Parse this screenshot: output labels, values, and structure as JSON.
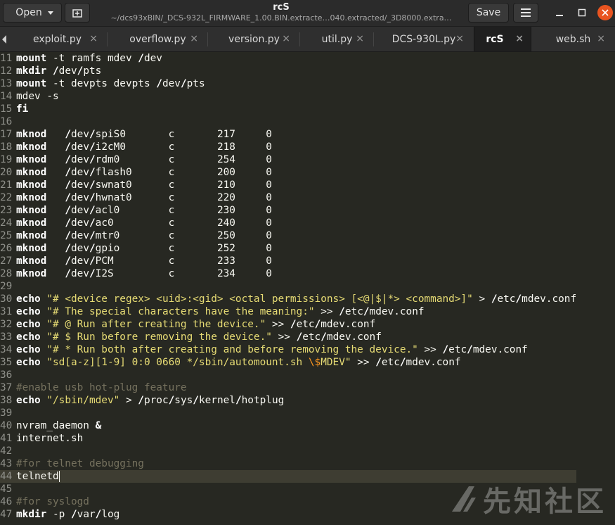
{
  "header": {
    "open_label": "Open",
    "title": "rcS",
    "subtitle": "~/dcs93xBIN/_DCS-932L_FIRMWARE_1.00.BIN.extracte…040.extracted/_3D8000.extra…",
    "save_label": "Save"
  },
  "tabs": [
    {
      "label": "exploit.py",
      "close": "×"
    },
    {
      "label": "overflow.py",
      "close": "×"
    },
    {
      "label": "version.py",
      "close": "×"
    },
    {
      "label": "util.py",
      "close": "×"
    },
    {
      "label": "DCS-930L.py",
      "close": "×"
    },
    {
      "label": "rcS",
      "close": "×",
      "active": true
    },
    {
      "label": "web.sh",
      "close": "×"
    }
  ],
  "editor": {
    "lines": [
      {
        "n": "11",
        "tokens": [
          [
            "kw",
            "mount"
          ],
          [
            "t",
            " -t ramfs mdev "
          ],
          [
            "op",
            "/"
          ],
          [
            "t",
            "dev"
          ]
        ]
      },
      {
        "n": "12",
        "tokens": [
          [
            "kw",
            "mkdir"
          ],
          [
            "t",
            " "
          ],
          [
            "op",
            "/"
          ],
          [
            "t",
            "dev"
          ],
          [
            "op",
            "/"
          ],
          [
            "t",
            "pts"
          ]
        ]
      },
      {
        "n": "13",
        "tokens": [
          [
            "kw",
            "mount"
          ],
          [
            "t",
            " -t devpts devpts "
          ],
          [
            "op",
            "/"
          ],
          [
            "t",
            "dev"
          ],
          [
            "op",
            "/"
          ],
          [
            "t",
            "pts"
          ]
        ]
      },
      {
        "n": "14",
        "tokens": [
          [
            "t",
            "mdev -s"
          ]
        ]
      },
      {
        "n": "15",
        "tokens": [
          [
            "kw",
            "fi"
          ]
        ]
      },
      {
        "n": "16",
        "tokens": []
      },
      {
        "n": "17",
        "tokens": [
          [
            "kw",
            "mknod"
          ],
          [
            "t",
            "   "
          ],
          [
            "op",
            "/"
          ],
          [
            "t",
            "dev"
          ],
          [
            "op",
            "/"
          ],
          [
            "t",
            "spiS0       c       217     0"
          ]
        ]
      },
      {
        "n": "18",
        "tokens": [
          [
            "kw",
            "mknod"
          ],
          [
            "t",
            "   "
          ],
          [
            "op",
            "/"
          ],
          [
            "t",
            "dev"
          ],
          [
            "op",
            "/"
          ],
          [
            "t",
            "i2cM0       c       218     0"
          ]
        ]
      },
      {
        "n": "19",
        "tokens": [
          [
            "kw",
            "mknod"
          ],
          [
            "t",
            "   "
          ],
          [
            "op",
            "/"
          ],
          [
            "t",
            "dev"
          ],
          [
            "op",
            "/"
          ],
          [
            "t",
            "rdm0        c       254     0"
          ]
        ]
      },
      {
        "n": "20",
        "tokens": [
          [
            "kw",
            "mknod"
          ],
          [
            "t",
            "   "
          ],
          [
            "op",
            "/"
          ],
          [
            "t",
            "dev"
          ],
          [
            "op",
            "/"
          ],
          [
            "t",
            "flash0      c       200     0"
          ]
        ]
      },
      {
        "n": "21",
        "tokens": [
          [
            "kw",
            "mknod"
          ],
          [
            "t",
            "   "
          ],
          [
            "op",
            "/"
          ],
          [
            "t",
            "dev"
          ],
          [
            "op",
            "/"
          ],
          [
            "t",
            "swnat0      c       210     0"
          ]
        ]
      },
      {
        "n": "22",
        "tokens": [
          [
            "kw",
            "mknod"
          ],
          [
            "t",
            "   "
          ],
          [
            "op",
            "/"
          ],
          [
            "t",
            "dev"
          ],
          [
            "op",
            "/"
          ],
          [
            "t",
            "hwnat0      c       220     0"
          ]
        ]
      },
      {
        "n": "23",
        "tokens": [
          [
            "kw",
            "mknod"
          ],
          [
            "t",
            "   "
          ],
          [
            "op",
            "/"
          ],
          [
            "t",
            "dev"
          ],
          [
            "op",
            "/"
          ],
          [
            "t",
            "acl0        c       230     0"
          ]
        ]
      },
      {
        "n": "24",
        "tokens": [
          [
            "kw",
            "mknod"
          ],
          [
            "t",
            "   "
          ],
          [
            "op",
            "/"
          ],
          [
            "t",
            "dev"
          ],
          [
            "op",
            "/"
          ],
          [
            "t",
            "ac0         c       240     0"
          ]
        ]
      },
      {
        "n": "25",
        "tokens": [
          [
            "kw",
            "mknod"
          ],
          [
            "t",
            "   "
          ],
          [
            "op",
            "/"
          ],
          [
            "t",
            "dev"
          ],
          [
            "op",
            "/"
          ],
          [
            "t",
            "mtr0        c       250     0"
          ]
        ]
      },
      {
        "n": "26",
        "tokens": [
          [
            "kw",
            "mknod"
          ],
          [
            "t",
            "   "
          ],
          [
            "op",
            "/"
          ],
          [
            "t",
            "dev"
          ],
          [
            "op",
            "/"
          ],
          [
            "t",
            "gpio        c       252     0"
          ]
        ]
      },
      {
        "n": "27",
        "tokens": [
          [
            "kw",
            "mknod"
          ],
          [
            "t",
            "   "
          ],
          [
            "op",
            "/"
          ],
          [
            "t",
            "dev"
          ],
          [
            "op",
            "/"
          ],
          [
            "t",
            "PCM         c       233     0"
          ]
        ]
      },
      {
        "n": "28",
        "tokens": [
          [
            "kw",
            "mknod"
          ],
          [
            "t",
            "   "
          ],
          [
            "op",
            "/"
          ],
          [
            "t",
            "dev"
          ],
          [
            "op",
            "/"
          ],
          [
            "t",
            "I2S         c       234     0"
          ]
        ]
      },
      {
        "n": "29",
        "tokens": []
      },
      {
        "n": "30",
        "tokens": [
          [
            "kw",
            "echo"
          ],
          [
            "t",
            " "
          ],
          [
            "str",
            "\"# <device regex> <uid>:<gid> <octal permissions> [<@|$|*> <command>]\""
          ],
          [
            "t",
            " > "
          ],
          [
            "op",
            "/"
          ],
          [
            "t",
            "etc"
          ],
          [
            "op",
            "/"
          ],
          [
            "t",
            "mdev.conf"
          ]
        ]
      },
      {
        "n": "31",
        "tokens": [
          [
            "kw",
            "echo"
          ],
          [
            "t",
            " "
          ],
          [
            "str",
            "\"# The special characters have the meaning:\""
          ],
          [
            "t",
            " >> "
          ],
          [
            "op",
            "/"
          ],
          [
            "t",
            "etc"
          ],
          [
            "op",
            "/"
          ],
          [
            "t",
            "mdev.conf"
          ]
        ]
      },
      {
        "n": "32",
        "tokens": [
          [
            "kw",
            "echo"
          ],
          [
            "t",
            " "
          ],
          [
            "str",
            "\"# @ Run after creating the device.\""
          ],
          [
            "t",
            " >> "
          ],
          [
            "op",
            "/"
          ],
          [
            "t",
            "etc"
          ],
          [
            "op",
            "/"
          ],
          [
            "t",
            "mdev.conf"
          ]
        ]
      },
      {
        "n": "33",
        "tokens": [
          [
            "kw",
            "echo"
          ],
          [
            "t",
            " "
          ],
          [
            "str",
            "\"# $ Run before removing the device.\""
          ],
          [
            "t",
            " >> "
          ],
          [
            "op",
            "/"
          ],
          [
            "t",
            "etc"
          ],
          [
            "op",
            "/"
          ],
          [
            "t",
            "mdev.conf"
          ]
        ]
      },
      {
        "n": "34",
        "tokens": [
          [
            "kw",
            "echo"
          ],
          [
            "t",
            " "
          ],
          [
            "str",
            "\"# * Run both after creating and before removing the device.\""
          ],
          [
            "t",
            " >> "
          ],
          [
            "op",
            "/"
          ],
          [
            "t",
            "etc"
          ],
          [
            "op",
            "/"
          ],
          [
            "t",
            "mdev.conf"
          ]
        ]
      },
      {
        "n": "35",
        "tokens": [
          [
            "kw",
            "echo"
          ],
          [
            "t",
            " "
          ],
          [
            "str",
            "\"sd[a-z][1-9] 0:0 0660 */sbin/automount.sh "
          ],
          [
            "var",
            "\\$"
          ],
          [
            "str",
            "MDEV\""
          ],
          [
            "t",
            " >> "
          ],
          [
            "op",
            "/"
          ],
          [
            "t",
            "etc"
          ],
          [
            "op",
            "/"
          ],
          [
            "t",
            "mdev.conf"
          ]
        ]
      },
      {
        "n": "36",
        "tokens": []
      },
      {
        "n": "37",
        "tokens": [
          [
            "cm",
            "#enable usb hot-plug feature"
          ]
        ]
      },
      {
        "n": "38",
        "tokens": [
          [
            "kw",
            "echo"
          ],
          [
            "t",
            " "
          ],
          [
            "str",
            "\"/sbin/mdev\""
          ],
          [
            "t",
            " > "
          ],
          [
            "op",
            "/"
          ],
          [
            "t",
            "proc"
          ],
          [
            "op",
            "/"
          ],
          [
            "t",
            "sys"
          ],
          [
            "op",
            "/"
          ],
          [
            "t",
            "kernel"
          ],
          [
            "op",
            "/"
          ],
          [
            "t",
            "hotplug"
          ]
        ]
      },
      {
        "n": "39",
        "tokens": []
      },
      {
        "n": "40",
        "tokens": [
          [
            "t",
            "nvram_daemon "
          ],
          [
            "op",
            "&"
          ]
        ]
      },
      {
        "n": "41",
        "tokens": [
          [
            "t",
            "internet.sh"
          ]
        ]
      },
      {
        "n": "42",
        "tokens": []
      },
      {
        "n": "43",
        "tokens": [
          [
            "cm",
            "#for telnet debugging"
          ]
        ]
      },
      {
        "n": "44",
        "tokens": [
          [
            "t",
            "telnetd"
          ]
        ],
        "current": true
      },
      {
        "n": "45",
        "tokens": []
      },
      {
        "n": "46",
        "tokens": [
          [
            "cm",
            "#for syslogd"
          ]
        ]
      },
      {
        "n": "47",
        "tokens": [
          [
            "kw",
            "mkdir"
          ],
          [
            "t",
            " -p "
          ],
          [
            "op",
            "/"
          ],
          [
            "t",
            "var"
          ],
          [
            "op",
            "/"
          ],
          [
            "t",
            "log"
          ]
        ]
      }
    ]
  },
  "watermark": {
    "text": "先知社区"
  },
  "icons": {
    "new_tab": "new-tab-icon",
    "menu": "hamburger-menu-icon",
    "minimize": "minimize-icon",
    "maximize": "maximize-icon",
    "close": "close-icon"
  },
  "colors": {
    "close_button": "#e95420",
    "string": "#e6db74",
    "comment": "#75715e",
    "background": "#272822"
  }
}
